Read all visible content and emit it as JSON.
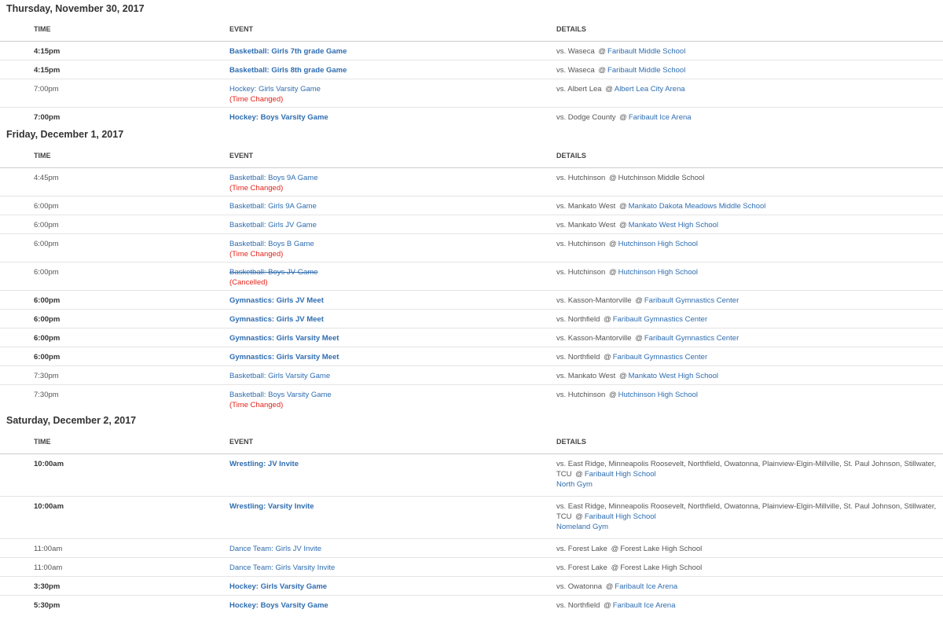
{
  "headers": {
    "time": "TIME",
    "event": "EVENT",
    "details": "DETAILS"
  },
  "symbols": {
    "at": "@"
  },
  "days": [
    {
      "title": "Thursday, November 30, 2017",
      "rows": [
        {
          "time": "4:15pm",
          "event": "Basketball: Girls 7th grade Game",
          "opp": "vs. Waseca",
          "loc": "Faribault Middle School",
          "bold": true
        },
        {
          "time": "4:15pm",
          "event": "Basketball: Girls 8th grade Game",
          "opp": "vs. Waseca",
          "loc": "Faribault Middle School",
          "bold": true
        },
        {
          "time": "7:00pm",
          "event": "Hockey: Girls Varsity Game",
          "note": "(Time Changed)",
          "opp": "vs. Albert Lea",
          "loc": "Albert Lea City Arena"
        },
        {
          "time": "7:00pm",
          "event": "Hockey: Boys Varsity Game",
          "opp": "vs. Dodge County",
          "loc": "Faribault Ice Arena",
          "bold": true
        }
      ]
    },
    {
      "title": "Friday, December 1, 2017",
      "rows": [
        {
          "time": "4:45pm",
          "event": "Basketball: Boys 9A Game",
          "note": "(Time Changed)",
          "opp": "vs. Hutchinson",
          "loc": "Hutchinson Middle School",
          "locplain": true
        },
        {
          "time": "6:00pm",
          "event": "Basketball: Girls 9A Game",
          "opp": "vs. Mankato West",
          "loc": "Mankato Dakota Meadows Middle School"
        },
        {
          "time": "6:00pm",
          "event": "Basketball: Girls JV Game",
          "opp": "vs. Mankato West",
          "loc": "Mankato West High School"
        },
        {
          "time": "6:00pm",
          "event": "Basketball: Boys B Game",
          "note": "(Time Changed)",
          "opp": "vs. Hutchinson",
          "loc": "Hutchinson High School"
        },
        {
          "time": "6:00pm",
          "event": "Basketball: Boys JV Game",
          "note": "(Cancelled)",
          "cancelled": true,
          "opp": "vs. Hutchinson",
          "loc": "Hutchinson High School"
        },
        {
          "time": "6:00pm",
          "event": "Gymnastics: Girls JV Meet",
          "opp": "vs. Kasson-Mantorville",
          "loc": "Faribault Gymnastics Center",
          "bold": true
        },
        {
          "time": "6:00pm",
          "event": "Gymnastics: Girls JV Meet",
          "opp": "vs. Northfield",
          "loc": "Faribault Gymnastics Center",
          "bold": true
        },
        {
          "time": "6:00pm",
          "event": "Gymnastics: Girls Varsity Meet",
          "opp": "vs. Kasson-Mantorville",
          "loc": "Faribault Gymnastics Center",
          "bold": true
        },
        {
          "time": "6:00pm",
          "event": "Gymnastics: Girls Varsity Meet",
          "opp": "vs. Northfield",
          "loc": "Faribault Gymnastics Center",
          "bold": true
        },
        {
          "time": "7:30pm",
          "event": "Basketball: Girls Varsity Game",
          "opp": "vs. Mankato West",
          "loc": "Mankato West High School"
        },
        {
          "time": "7:30pm",
          "event": "Basketball: Boys Varsity Game",
          "note": "(Time Changed)",
          "opp": "vs. Hutchinson",
          "loc": "Hutchinson High School"
        }
      ]
    },
    {
      "title": "Saturday, December 2, 2017",
      "rows": [
        {
          "time": "10:00am",
          "event": "Wrestling: JV Invite",
          "opp": "vs. East Ridge, Minneapolis Roosevelt, Northfield, Owatonna, Plainview-Elgin-Millville, St. Paul Johnson, Stillwater, TCU",
          "loc": "Faribault High School",
          "room": "North Gym",
          "bold": true
        },
        {
          "time": "10:00am",
          "event": "Wrestling: Varsity Invite",
          "opp": "vs. East Ridge, Minneapolis Roosevelt, Northfield, Owatonna, Plainview-Elgin-Millville, St. Paul Johnson, Stillwater, TCU",
          "loc": "Faribault High School",
          "room": "Nomeland Gym",
          "bold": true
        },
        {
          "time": "11:00am",
          "event": "Dance Team: Girls JV Invite",
          "opp": "vs. Forest Lake",
          "loc": "Forest Lake High School",
          "locplain": true
        },
        {
          "time": "11:00am",
          "event": "Dance Team: Girls Varsity Invite",
          "opp": "vs. Forest Lake",
          "loc": "Forest Lake High School",
          "locplain": true
        },
        {
          "time": "3:30pm",
          "event": "Hockey: Girls Varsity Game",
          "opp": "vs. Owatonna",
          "loc": "Faribault Ice Arena",
          "bold": true
        },
        {
          "time": "5:30pm",
          "event": "Hockey: Boys Varsity Game",
          "opp": "vs. Northfield",
          "loc": "Faribault Ice Arena",
          "bold": true
        }
      ]
    }
  ]
}
